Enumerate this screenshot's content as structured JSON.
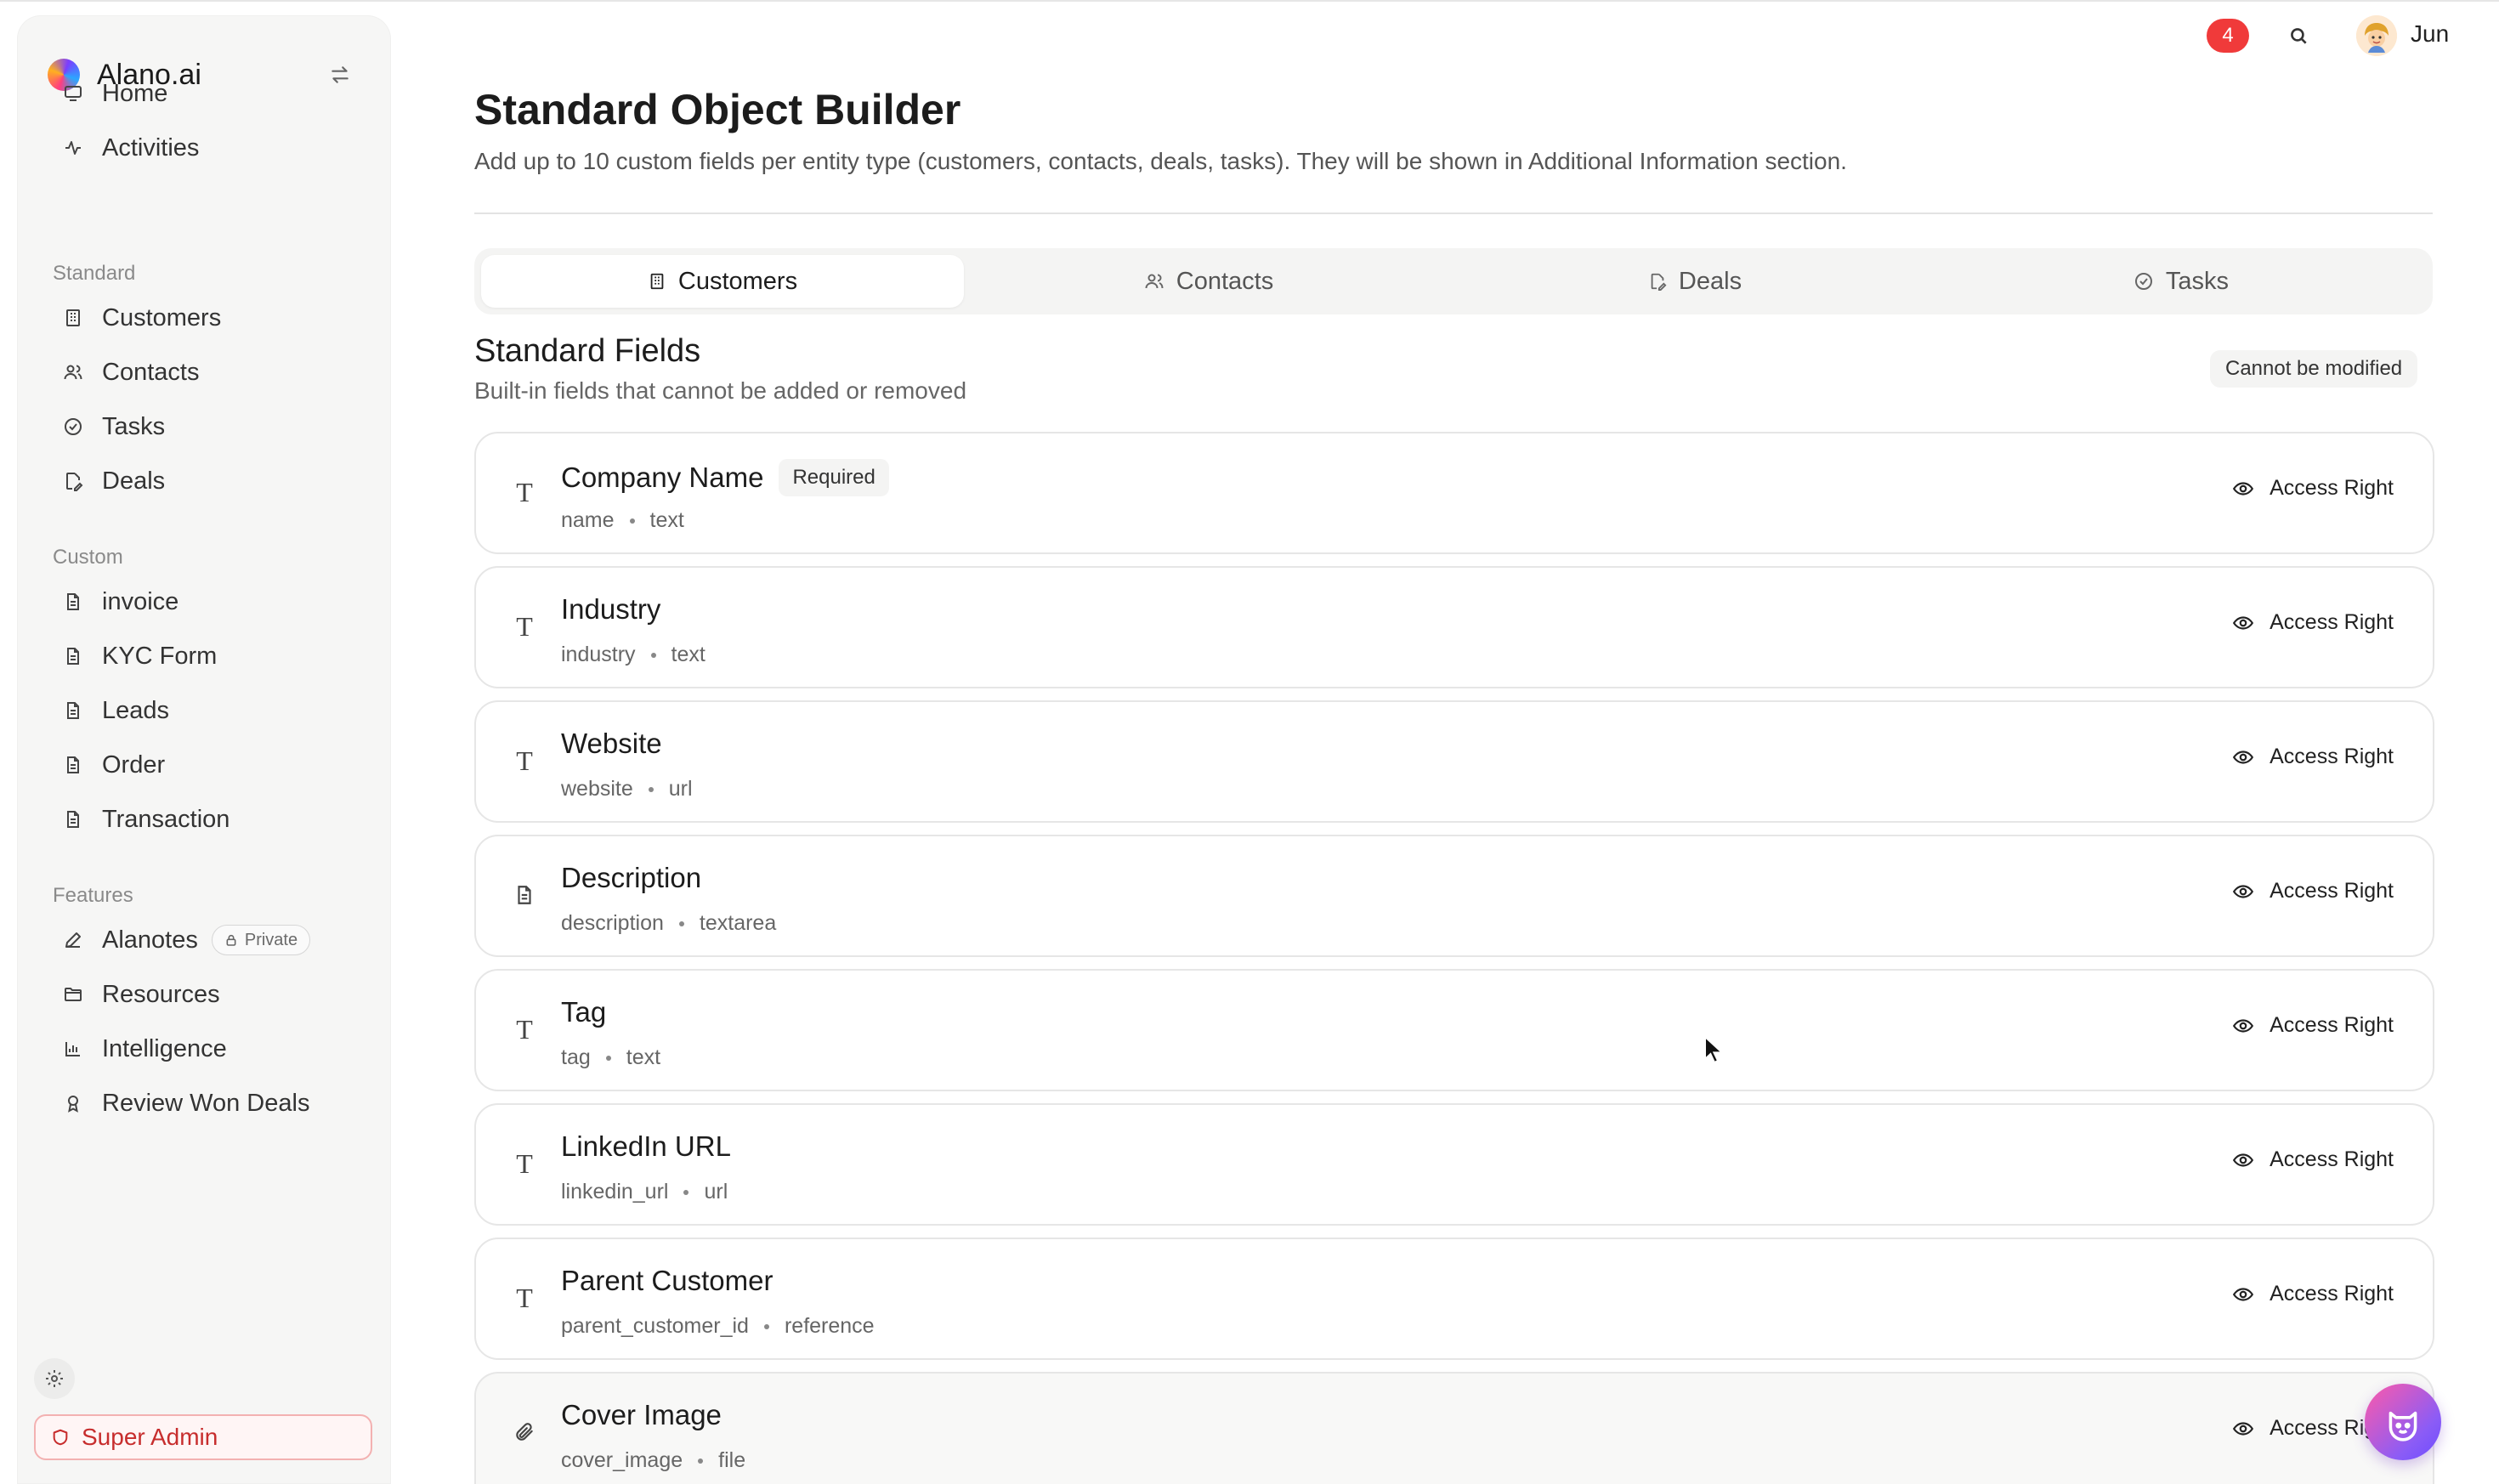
{
  "brand": {
    "name": "Alano.ai"
  },
  "sidebar": {
    "main": [
      {
        "label": "Home",
        "icon": "monitor-icon"
      },
      {
        "label": "Activities",
        "icon": "activity-icon"
      }
    ],
    "standard_label": "Standard",
    "standard": [
      {
        "label": "Customers",
        "icon": "building-icon"
      },
      {
        "label": "Contacts",
        "icon": "users-icon"
      },
      {
        "label": "Tasks",
        "icon": "check-circle-icon"
      },
      {
        "label": "Deals",
        "icon": "file-edit-icon"
      }
    ],
    "custom_label": "Custom",
    "custom": [
      {
        "label": "invoice",
        "icon": "document-icon"
      },
      {
        "label": "KYC Form",
        "icon": "document-icon"
      },
      {
        "label": "Leads",
        "icon": "document-icon"
      },
      {
        "label": "Order",
        "icon": "document-icon"
      },
      {
        "label": "Transaction",
        "icon": "document-icon"
      }
    ],
    "features_label": "Features",
    "features": [
      {
        "label": "Alanotes",
        "icon": "pen-icon",
        "badge": "Private"
      },
      {
        "label": "Resources",
        "icon": "folder-icon"
      },
      {
        "label": "Intelligence",
        "icon": "bar-chart-icon"
      },
      {
        "label": "Review Won Deals",
        "icon": "award-icon"
      }
    ],
    "admin_label": "Super Admin"
  },
  "topbar": {
    "notification_count": "4",
    "user_name": "Jun"
  },
  "page": {
    "title": "Standard Object Builder",
    "subtitle": "Add up to 10 custom fields per entity type (customers, contacts, deals, tasks). They will be shown in Additional Information section."
  },
  "tabs": [
    {
      "label": "Customers",
      "active": true
    },
    {
      "label": "Contacts",
      "active": false
    },
    {
      "label": "Deals",
      "active": false
    },
    {
      "label": "Tasks",
      "active": false
    }
  ],
  "standard_fields": {
    "title": "Standard Fields",
    "subtitle": "Built-in fields that cannot be added or removed",
    "badge": "Cannot be modified",
    "access_label": "Access Right",
    "required_label": "Required",
    "fields": [
      {
        "name": "Company Name",
        "key": "name",
        "type": "text",
        "required": true,
        "icon": "text-type-icon"
      },
      {
        "name": "Industry",
        "key": "industry",
        "type": "text",
        "icon": "text-type-icon"
      },
      {
        "name": "Website",
        "key": "website",
        "type": "url",
        "icon": "text-type-icon"
      },
      {
        "name": "Description",
        "key": "description",
        "type": "textarea",
        "icon": "document-icon"
      },
      {
        "name": "Tag",
        "key": "tag",
        "type": "text",
        "icon": "text-type-icon"
      },
      {
        "name": "LinkedIn URL",
        "key": "linkedin_url",
        "type": "url",
        "icon": "text-type-icon"
      },
      {
        "name": "Parent Customer",
        "key": "parent_customer_id",
        "type": "reference",
        "icon": "text-type-icon"
      },
      {
        "name": "Cover Image",
        "key": "cover_image",
        "type": "file",
        "icon": "paperclip-icon"
      }
    ]
  }
}
